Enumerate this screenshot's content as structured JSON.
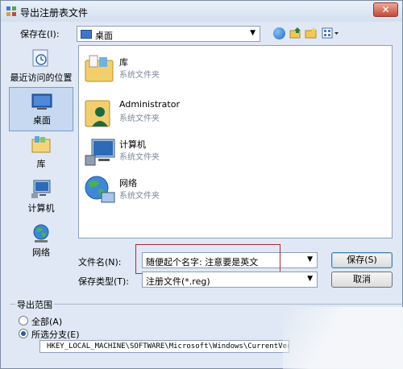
{
  "window": {
    "title": "导出注册表文件",
    "close_label": "✕"
  },
  "toolbar": {
    "save_in_label": "保存在(I):",
    "save_in_value": "桌面"
  },
  "places": [
    {
      "label": "最近访问的位置"
    },
    {
      "label": "桌面"
    },
    {
      "label": "库"
    },
    {
      "label": "计算机"
    },
    {
      "label": "网络"
    }
  ],
  "files": [
    {
      "name": "库",
      "type": "系统文件夹"
    },
    {
      "name": "Administrator",
      "type": "系统文件夹"
    },
    {
      "name": "计算机",
      "type": "系统文件夹"
    },
    {
      "name": "网络",
      "type": "系统文件夹"
    }
  ],
  "form": {
    "filename_label": "文件名(N):",
    "filename_value": "随便起个名字: 注意要是英文",
    "filetype_label": "保存类型(T):",
    "filetype_value": "注册文件(*.reg)"
  },
  "buttons": {
    "save": "保存(S)",
    "cancel": "取消"
  },
  "export_range": {
    "title": "导出范围",
    "all_label": "全部(A)",
    "selected_label": "所选分支(E)",
    "path": "HKEY_LOCAL_MACHINE\\SOFTWARE\\Microsoft\\Windows\\CurrentVersi"
  }
}
